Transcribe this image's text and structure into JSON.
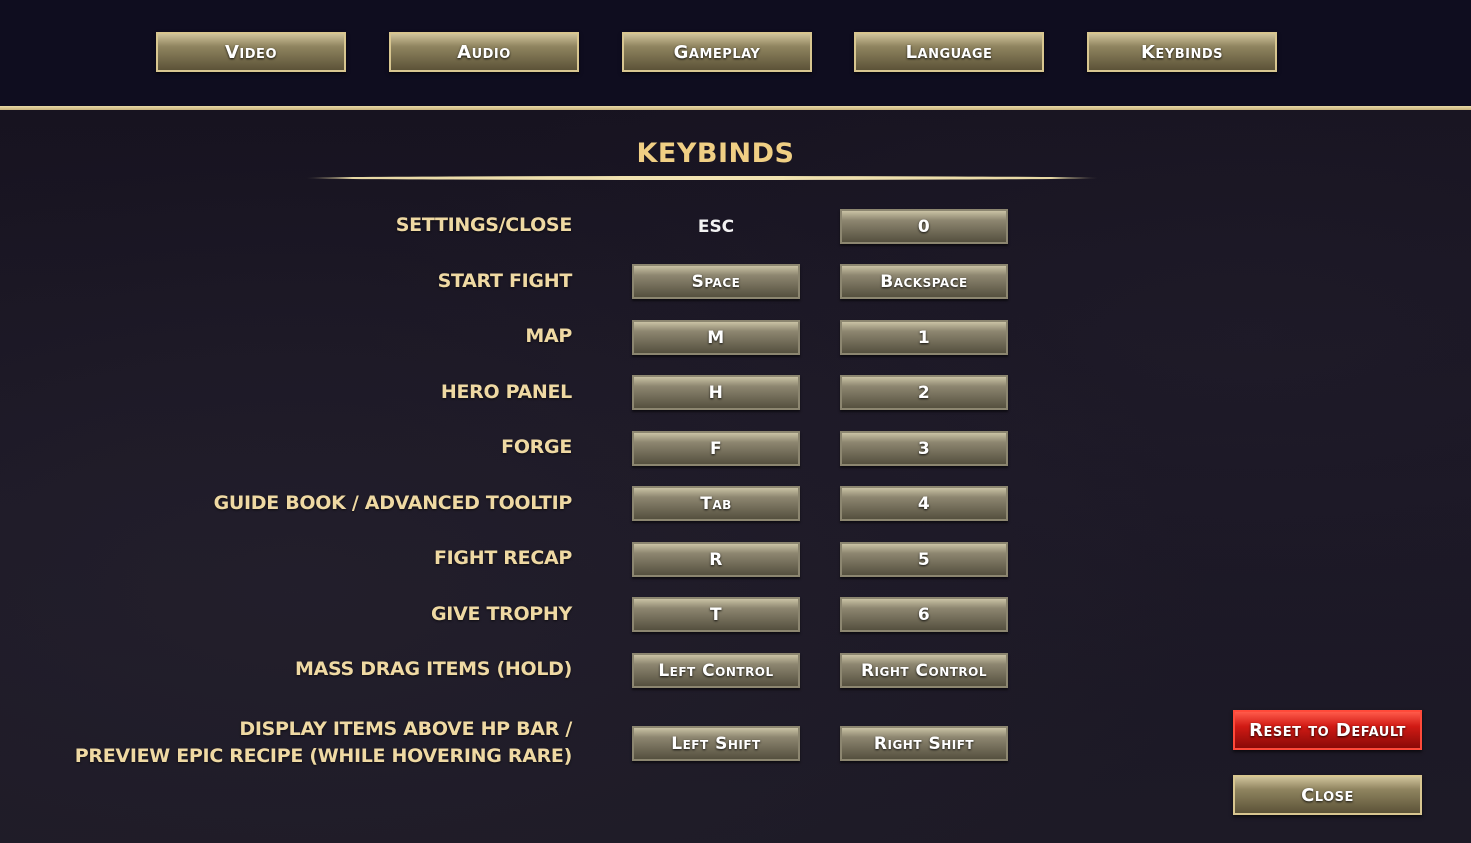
{
  "tabs": [
    {
      "label": "Video"
    },
    {
      "label": "Audio"
    },
    {
      "label": "Gameplay"
    },
    {
      "label": "Language"
    },
    {
      "label": "Keybinds"
    }
  ],
  "section_title": "KEYBINDS",
  "rows": [
    {
      "label": "SETTINGS/CLOSE",
      "primary": "ESC",
      "secondary": "0"
    },
    {
      "label": "START FIGHT",
      "primary": "Space",
      "secondary": "Backspace"
    },
    {
      "label": "MAP",
      "primary": "M",
      "secondary": "1"
    },
    {
      "label": "HERO PANEL",
      "primary": "H",
      "secondary": "2"
    },
    {
      "label": "FORGE",
      "primary": "F",
      "secondary": "3"
    },
    {
      "label": "GUIDE BOOK / ADVANCED TOOLTIP",
      "primary": "Tab",
      "secondary": "4"
    },
    {
      "label": "FIGHT RECAP",
      "primary": "R",
      "secondary": "5"
    },
    {
      "label": "GIVE TROPHY",
      "primary": "T",
      "secondary": "6"
    },
    {
      "label": "MASS DRAG ITEMS (HOLD)",
      "primary": "Left Control",
      "secondary": "Right Control"
    },
    {
      "label_line1": "DISPLAY ITEMS ABOVE HP BAR /",
      "label_line2": "PREVIEW EPIC RECIPE (WHILE HOVERING RARE)",
      "primary": "Left Shift",
      "secondary": "Right Shift"
    }
  ],
  "buttons": {
    "reset_label": "Reset to Default",
    "close_label": "Close"
  },
  "colors": {
    "background": "#16121f",
    "topbar": "#0f0d1f",
    "gold_accent": "#e8d9a6",
    "title_text": "#f0cf84",
    "label_text": "#efd9a3",
    "reset_red": "#d01a14"
  }
}
